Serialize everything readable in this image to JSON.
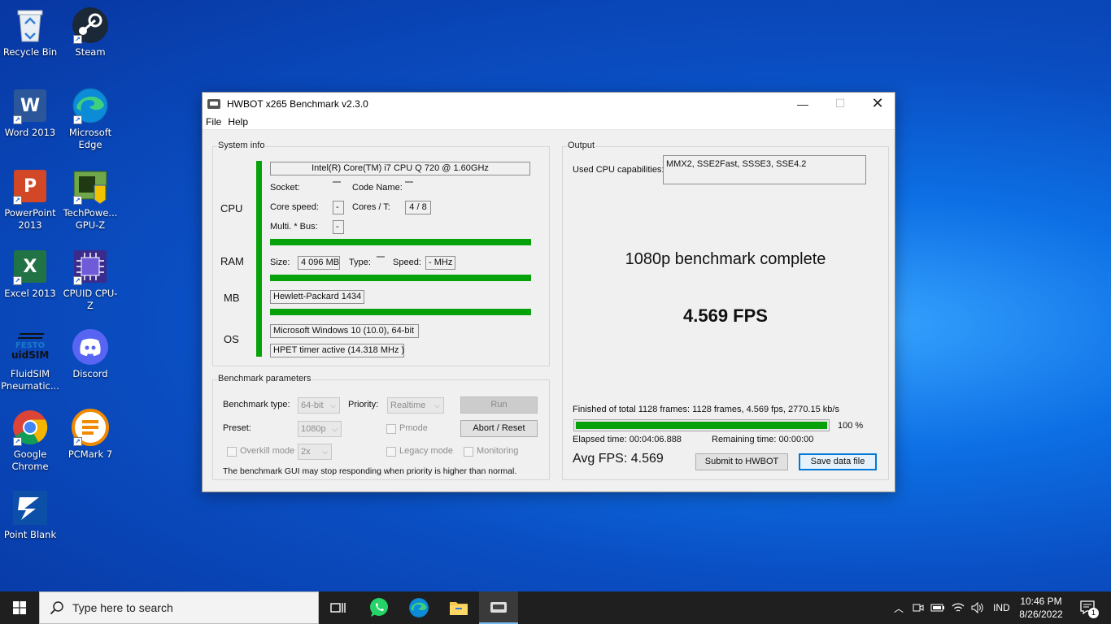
{
  "desktop": {
    "icons": [
      {
        "label": "Recycle Bin"
      },
      {
        "label": "Steam"
      },
      {
        "label": "Word 2013"
      },
      {
        "label": "Microsoft Edge"
      },
      {
        "label": "PowerPoint 2013"
      },
      {
        "label": "TechPowe... GPU-Z"
      },
      {
        "label": "Excel 2013"
      },
      {
        "label": "CPUID CPU-Z"
      },
      {
        "label": "FluidSIM Pneumatic..."
      },
      {
        "label": "Discord"
      },
      {
        "label": "Google Chrome"
      },
      {
        "label": "PCMark 7"
      },
      {
        "label": "Point Blank"
      }
    ],
    "festo_logo_text": "FESTO",
    "fluidsim_logo_text": "uidSIM"
  },
  "window": {
    "title": "HWBOT x265 Benchmark v2.3.0",
    "menu": [
      "File",
      "Help"
    ],
    "system_info": {
      "group_title": "System info",
      "cpu_label": "CPU",
      "ram_label": "RAM",
      "mb_label": "MB",
      "os_label": "OS",
      "cpu_name": "Intel(R) Core(TM) i7 CPU       Q 720  @ 1.60GHz",
      "socket_label": "Socket:",
      "socket_value": "",
      "code_name_label": "Code Name:",
      "code_name_value": "",
      "core_speed_label": "Core speed:",
      "core_speed_value": "-",
      "cores_label": "Cores / T:",
      "cores_value": "4 / 8",
      "multi_label": "Multi. * Bus:",
      "multi_value": "-",
      "size_label": "Size:",
      "size_value": "4 096 MB",
      "type_label": "Type:",
      "type_value": "",
      "speed_label": "Speed:",
      "speed_value": "- MHz",
      "mb_value": "Hewlett-Packard 1434",
      "os_value": "Microsoft Windows 10 (10.0), 64-bit",
      "timer_value": "HPET timer active (14.318 MHz )"
    },
    "params": {
      "group_title": "Benchmark parameters",
      "benchmark_type_label": "Benchmark type:",
      "benchmark_type_value": "64-bit",
      "priority_label": "Priority:",
      "priority_value": "Realtime",
      "run_label": "Run",
      "preset_label": "Preset:",
      "preset_value": "1080p",
      "pmode_label": "Pmode",
      "abort_label": "Abort / Reset",
      "overkill_label": "Overkill mode",
      "overkill_value": "2x",
      "legacy_label": "Legacy mode",
      "monitoring_label": "Monitoring",
      "note": "The benchmark GUI may stop responding when priority is higher than normal."
    },
    "output": {
      "group_title": "Output",
      "cpu_caps_label": "Used CPU capabilities:",
      "cpu_caps_value": "MMX2, SSE2Fast, SSSE3, SSE4.2",
      "status": "1080p benchmark complete",
      "fps": "4.569 FPS",
      "finished_text": "Finished of total 1128 frames: 1128 frames, 4.569 fps,  2770.15 kb/s",
      "progress": 1.0,
      "progress_text": "100 %",
      "elapsed": "Elapsed time: 00:04:06.888",
      "remaining": "Remaining time: 00:00:00",
      "avg_fps": "Avg FPS: 4.569",
      "submit_label": "Submit to HWBOT",
      "save_label": "Save data file"
    }
  },
  "taskbar": {
    "search_placeholder": "Type here to search",
    "language": "IND",
    "time": "10:46 PM",
    "date": "8/26/2022",
    "notification_count": "1"
  },
  "colors": {
    "progress_green": "#07a10a",
    "focus_blue": "#0078d7"
  }
}
